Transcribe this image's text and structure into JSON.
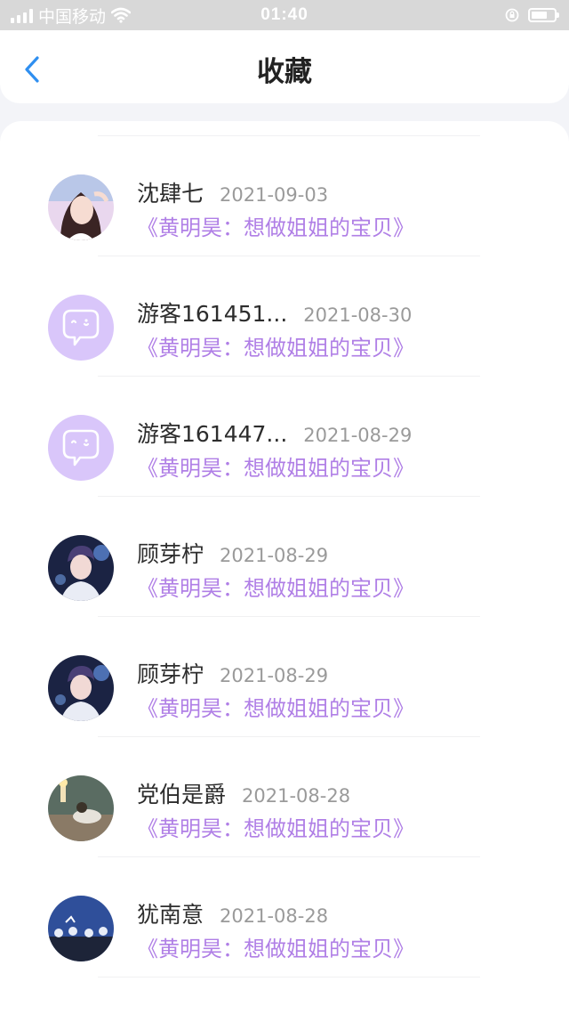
{
  "status_bar": {
    "carrier": "中国移动",
    "time": "01:40"
  },
  "header": {
    "title": "收藏"
  },
  "favorites": [
    {
      "user": "沈肆七",
      "date": "2021-09-03",
      "work": "《黄明昊：想做姐姐的宝贝》",
      "avatar": "photo-girl"
    },
    {
      "user": "游客161451...",
      "date": "2021-08-30",
      "work": "《黄明昊：想做姐姐的宝贝》",
      "avatar": "default-chat-bubble"
    },
    {
      "user": "游客161447...",
      "date": "2021-08-29",
      "work": "《黄明昊：想做姐姐的宝贝》",
      "avatar": "default-chat-bubble"
    },
    {
      "user": "顾芽柠",
      "date": "2021-08-29",
      "work": "《黄明昊：想做姐姐的宝贝》",
      "avatar": "photo-boy-stage"
    },
    {
      "user": "顾芽柠",
      "date": "2021-08-29",
      "work": "《黄明昊：想做姐姐的宝贝》",
      "avatar": "photo-boy-stage"
    },
    {
      "user": "党伯是爵",
      "date": "2021-08-28",
      "work": "《黄明昊：想做姐姐的宝贝》",
      "avatar": "photo-scene"
    },
    {
      "user": "犹南意",
      "date": "2021-08-28",
      "work": "《黄明昊：想做姐姐的宝贝》",
      "avatar": "photo-crowd"
    }
  ],
  "colors": {
    "accent_purple": "#b07fe6",
    "back_blue": "#2f8ff0",
    "default_avatar": "#d9c6fa"
  }
}
